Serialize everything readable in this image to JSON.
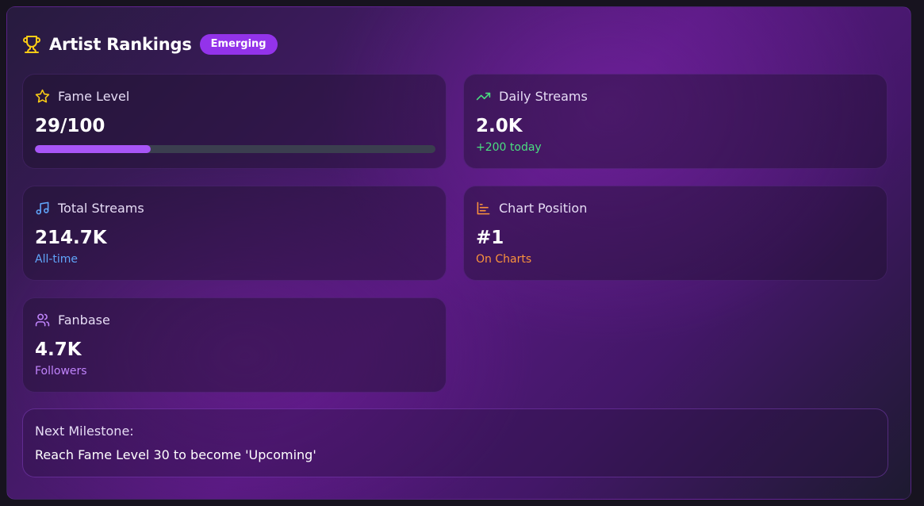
{
  "header": {
    "title": "Artist Rankings",
    "badge": "Emerging",
    "icon": "trophy-icon"
  },
  "cards": [
    {
      "label": "Fame Level",
      "value": "29/100",
      "icon": "star-icon",
      "progress": 0.29
    },
    {
      "label": "Daily Streams",
      "value": "2.0K",
      "sub": "+200 today",
      "icon": "trending-up-icon",
      "sub_color": "#4ade80"
    },
    {
      "label": "Total Streams",
      "value": "214.7K",
      "sub": "All-time",
      "icon": "music-note-icon",
      "sub_color": "#60a5fa"
    },
    {
      "label": "Chart Position",
      "value": "#1",
      "sub": "On Charts",
      "icon": "bar-chart-icon",
      "sub_color": "#fb923c"
    },
    {
      "label": "Fanbase",
      "value": "4.7K",
      "sub": "Followers",
      "icon": "users-icon",
      "sub_color": "#c084fc"
    }
  ],
  "milestone": {
    "title": "Next Milestone:",
    "text": "Reach Fame Level 30 to become 'Upcoming'"
  },
  "colors": {
    "accent": "#a855f7",
    "badge": "#9333ea",
    "trophy": "#facc15"
  }
}
